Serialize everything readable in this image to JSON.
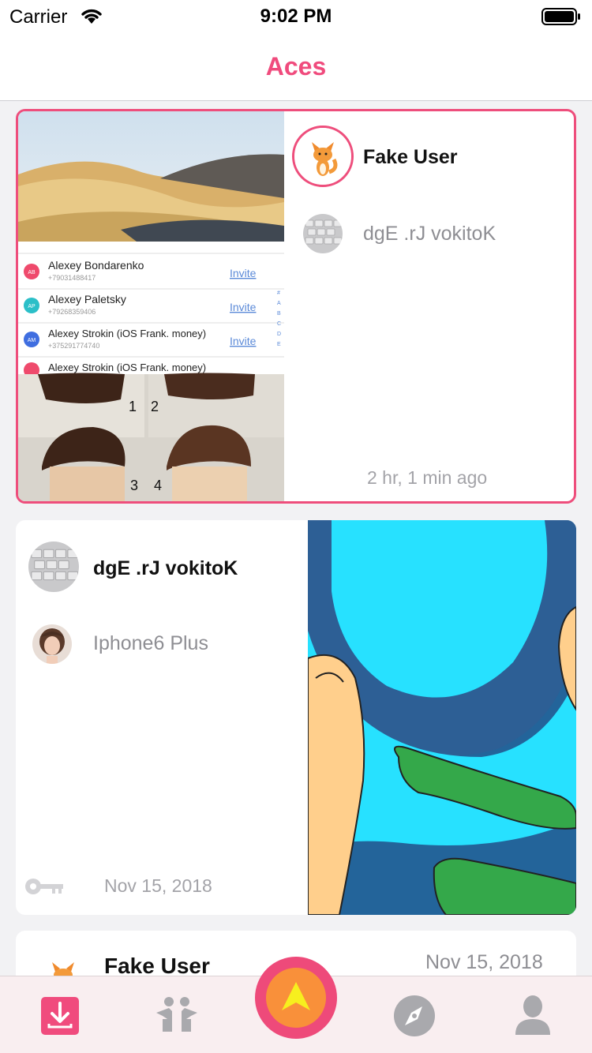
{
  "status_bar": {
    "carrier": "Carrier",
    "time": "9:02 PM",
    "icons": [
      "wifi-icon",
      "battery-icon"
    ]
  },
  "nav": {
    "title": "Aces",
    "accent_color": "#f04b7d"
  },
  "cards": [
    {
      "selected": true,
      "primary_user": "Fake User",
      "secondary_user": "dgE .rJ vokitoK",
      "time": "2 hr, 1 min ago",
      "photo_text": {
        "contacts": [
          {
            "name": "Alexey Bondarenko",
            "phone": "+79031488417",
            "action": "Invite"
          },
          {
            "name": "Alexey Paletsky",
            "phone": "+79268359406",
            "action": "Invite"
          },
          {
            "name": "Alexey Strokin (iOS Frank. money)",
            "phone": "+375291774740",
            "action": "Invite"
          },
          {
            "name": "Alexey Strokin (iOS Frank. money)",
            "phone": "",
            "action": ""
          }
        ],
        "initials": [
          "AB",
          "AP",
          "AM",
          ""
        ],
        "index_letters": [
          "#",
          "A",
          "B",
          "C",
          "D",
          "E"
        ],
        "hair_numbers": [
          "1",
          "2",
          "3",
          "4"
        ]
      }
    },
    {
      "selected": false,
      "primary_user": "dgE .rJ vokitoK",
      "secondary_user": "Iphone6 Plus",
      "time": "Nov 15, 2018",
      "icon": "key-icon"
    },
    {
      "selected": false,
      "primary_user": "Fake User",
      "time": "Nov 15, 2018"
    }
  ],
  "tab_bar": {
    "items": [
      "inbox-icon",
      "friends-icon",
      "aces-icon",
      "explore-icon",
      "profile-icon"
    ],
    "active": "inbox-icon"
  }
}
